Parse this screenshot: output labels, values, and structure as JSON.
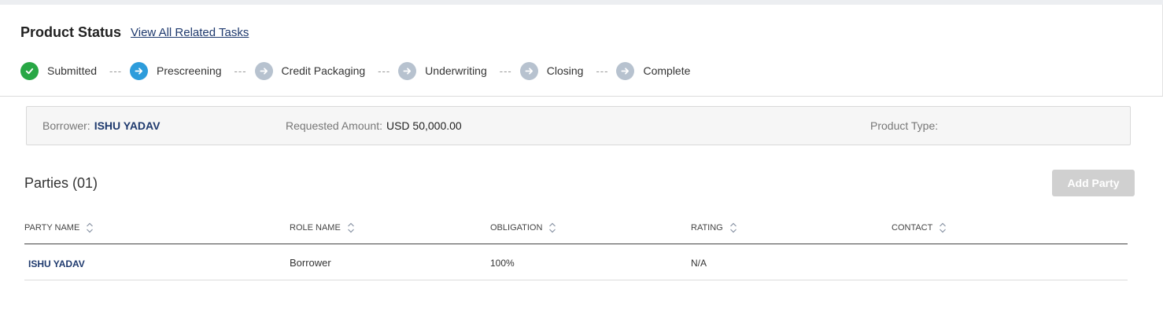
{
  "product_status": {
    "title": "Product Status",
    "link": "View All Related Tasks",
    "steps": [
      {
        "label": "Submitted",
        "state": "done",
        "icon": "check-icon",
        "color": "#28a745"
      },
      {
        "label": "Prescreening",
        "state": "current",
        "icon": "arrow-right-icon",
        "color": "#2d9cdb"
      },
      {
        "label": "Credit Packaging",
        "state": "pending",
        "icon": "arrow-right-icon",
        "color": "#b7c2cf"
      },
      {
        "label": "Underwriting",
        "state": "pending",
        "icon": "arrow-right-icon",
        "color": "#b7c2cf"
      },
      {
        "label": "Closing",
        "state": "pending",
        "icon": "arrow-right-icon",
        "color": "#b7c2cf"
      },
      {
        "label": "Complete",
        "state": "pending",
        "icon": "arrow-right-icon",
        "color": "#b7c2cf"
      }
    ],
    "separator": "---"
  },
  "info": {
    "borrower_label": "Borrower:",
    "borrower_value": "ISHU YADAV",
    "amount_label": "Requested Amount:",
    "amount_value": "USD 50,000.00",
    "product_type_label": "Product Type:",
    "product_type_value": ""
  },
  "parties": {
    "title": "Parties (01)",
    "add_button": "Add Party",
    "columns": [
      "PARTY NAME",
      "ROLE NAME",
      "OBLIGATION",
      "RATING",
      "CONTACT"
    ],
    "rows": [
      {
        "party_name": "ISHU YADAV",
        "role_name": "Borrower",
        "obligation": "100%",
        "rating": "N/A",
        "contact": ""
      }
    ]
  },
  "colors": {
    "accent": "#1f3a6e",
    "done": "#28a745",
    "current": "#2d9cdb",
    "pending": "#b7c2cf",
    "disabled_button": "#d0d0d0"
  }
}
